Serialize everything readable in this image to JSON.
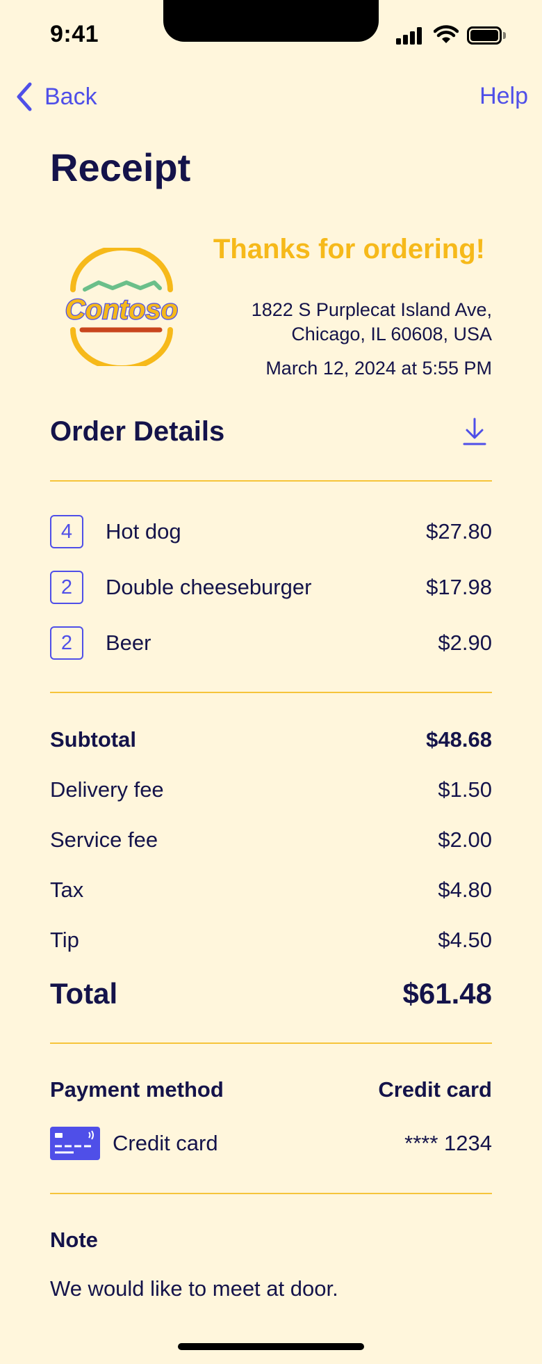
{
  "status_bar": {
    "time": "9:41"
  },
  "nav": {
    "back_label": "Back",
    "help_label": "Help"
  },
  "page_title": "Receipt",
  "restaurant": {
    "logo_text": "Contoso",
    "thanks": "Thanks for ordering!",
    "address_line1": "1822 S Purplecat Island Ave,",
    "address_line2": "Chicago, IL 60608, USA",
    "datetime": "March 12, 2024 at 5:55 PM"
  },
  "order": {
    "section_title": "Order Details",
    "items": [
      {
        "qty": "4",
        "name": "Hot dog",
        "price": "$27.80"
      },
      {
        "qty": "2",
        "name": "Double cheeseburger",
        "price": "$17.98"
      },
      {
        "qty": "2",
        "name": "Beer",
        "price": "$2.90"
      }
    ]
  },
  "summary": {
    "subtotal": {
      "label": "Subtotal",
      "value": "$48.68"
    },
    "delivery": {
      "label": "Delivery fee",
      "value": "$1.50"
    },
    "service": {
      "label": "Service fee",
      "value": "$2.00"
    },
    "tax": {
      "label": "Tax",
      "value": "$4.80"
    },
    "tip": {
      "label": "Tip",
      "value": "$4.50"
    },
    "total": {
      "label": "Total",
      "value": "$61.48"
    }
  },
  "payment": {
    "heading": "Payment method",
    "method_type": "Credit card",
    "card_label": "Credit card",
    "card_number": "**** 1234",
    "icon": "credit-card-icon"
  },
  "note": {
    "title": "Note",
    "text": "We would like to meet at door."
  },
  "colors": {
    "background": "#FFF6DC",
    "primary_text": "#14134A",
    "accent": "#4F4FE8",
    "highlight": "#F6B91A",
    "divider": "#F6C43A"
  }
}
